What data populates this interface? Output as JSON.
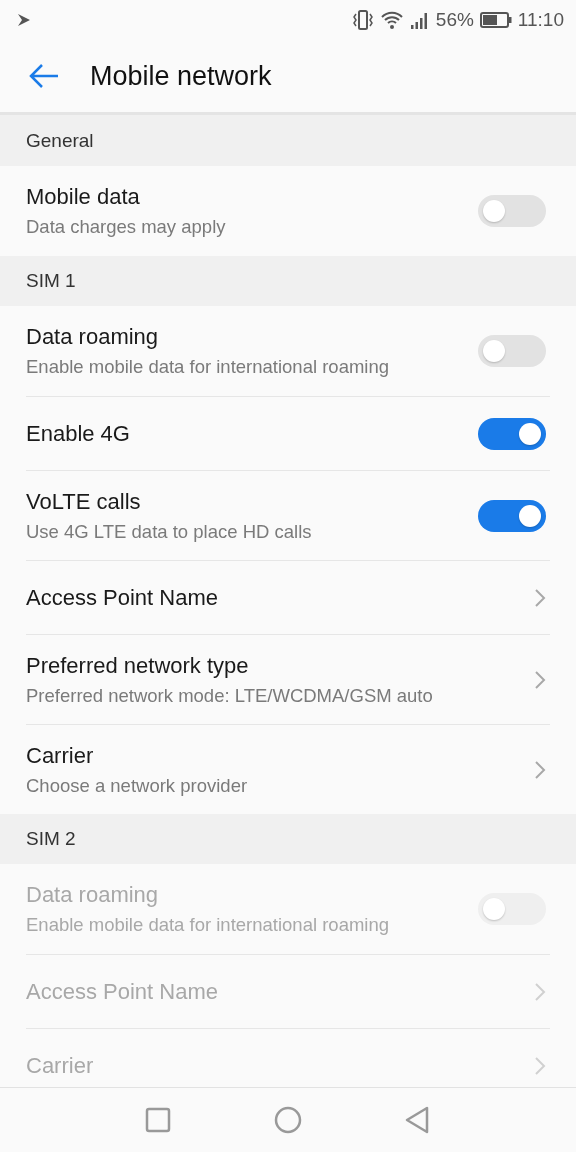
{
  "status_bar": {
    "battery_percent": "56%",
    "time": "11:10"
  },
  "app_bar": {
    "title": "Mobile network"
  },
  "sections": [
    {
      "header": "General",
      "items": [
        {
          "kind": "toggle",
          "title": "Mobile data",
          "subtitle": "Data charges may apply",
          "on": false,
          "disabled": false
        }
      ]
    },
    {
      "header": "SIM 1",
      "items": [
        {
          "kind": "toggle",
          "title": "Data roaming",
          "subtitle": "Enable mobile data for international roaming",
          "on": false,
          "disabled": false
        },
        {
          "kind": "toggle",
          "title": "Enable 4G",
          "on": true,
          "disabled": false
        },
        {
          "kind": "toggle",
          "title": "VoLTE calls",
          "subtitle": "Use 4G LTE data to place HD calls",
          "on": true,
          "disabled": false
        },
        {
          "kind": "link",
          "title": "Access Point Name",
          "disabled": false
        },
        {
          "kind": "link",
          "title": "Preferred network type",
          "subtitle": "Preferred network mode: LTE/WCDMA/GSM auto",
          "disabled": false
        },
        {
          "kind": "link",
          "title": "Carrier",
          "subtitle": "Choose a network provider",
          "disabled": false
        }
      ]
    },
    {
      "header": "SIM 2",
      "items": [
        {
          "kind": "toggle",
          "title": "Data roaming",
          "subtitle": "Enable mobile data for international roaming",
          "on": false,
          "disabled": true
        },
        {
          "kind": "link",
          "title": "Access Point Name",
          "disabled": true
        },
        {
          "kind": "link",
          "title": "Carrier",
          "disabled": true
        }
      ]
    }
  ]
}
